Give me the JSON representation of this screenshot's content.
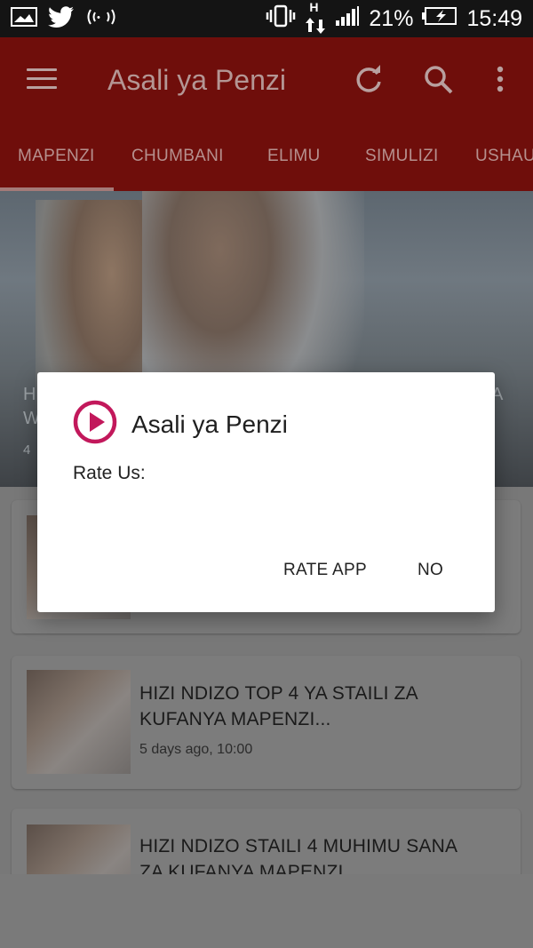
{
  "status_bar": {
    "battery": "21%",
    "time": "15:49",
    "network_letter": "H",
    "icons": [
      "gallery-icon",
      "twitter-icon",
      "hotspot-icon",
      "vibrate-icon",
      "data-arrows-icon",
      "signal-icon",
      "battery-charging-icon"
    ]
  },
  "app_bar": {
    "title": "Asali ya Penzi",
    "icons": [
      "menu-icon",
      "refresh-icon",
      "search-icon",
      "overflow-menu-icon"
    ]
  },
  "tabs": [
    "MAPENZI",
    "CHUMBANI",
    "ELIMU",
    "SIMULIZI",
    "USHAU"
  ],
  "selected_tab": "MAPENZI",
  "hero": {
    "text_fragment_left": "H",
    "text_fragment_left2": "W",
    "text_fragment_right": "A",
    "meta_fragment": "4"
  },
  "articles": [
    {
      "title_line1": "HIZI NDIZO TOP 4 YA STAILI ZA",
      "title_line2": "KUFANYA MAPENZI...",
      "meta": "5 days ago, 10:00"
    },
    {
      "title_line1": "HIZI NDIZO STAILI 4 MUHIMU SANA",
      "title_line2": "ZA KUFANYA MAPENZI",
      "meta": ""
    }
  ],
  "dialog": {
    "title": "Asali ya Penzi",
    "message": "Rate Us:",
    "positive_button": "RATE APP",
    "negative_button": "NO",
    "accent_color": "#c2185b"
  },
  "colors": {
    "app_bar": "#6f0e0b",
    "status_bar": "#141414",
    "scrim_background": "#7a7a7a"
  }
}
